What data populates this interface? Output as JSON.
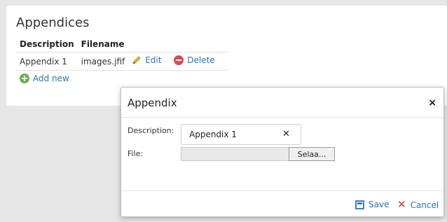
{
  "appendices": {
    "title": "Appendices",
    "columns": [
      "Description",
      "Filename"
    ],
    "rows": [
      {
        "description": "Appendix 1",
        "filename": "images.jfif",
        "edit_label": "Edit",
        "delete_label": "Delete"
      }
    ],
    "add_new_label": "Add new"
  },
  "dialog": {
    "title": "Appendix",
    "close_icon": "×",
    "description_label": "Description:",
    "description_value": "Appendix 1",
    "clear_icon": "✕",
    "file_label": "File:",
    "browse_label": "Selaa...",
    "save_label": "Save",
    "cancel_label": "Cancel",
    "cancel_icon": "✕"
  },
  "colors": {
    "link": "#2a73b6",
    "delete": "#e04a4a",
    "add": "#6ab04c",
    "cancel": "#d9343a"
  }
}
